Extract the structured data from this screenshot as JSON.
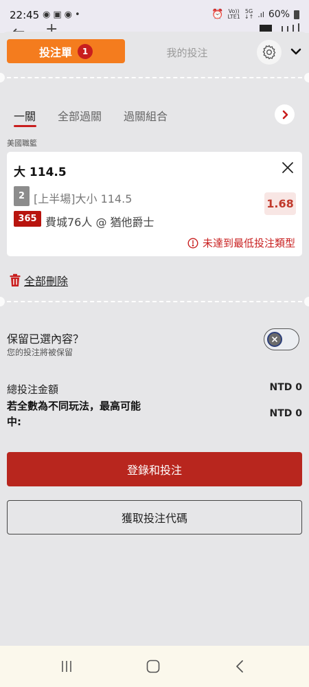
{
  "status_bar": {
    "time": "22:45",
    "battery": "60%",
    "network_top": "Vo))",
    "network_bottom": "LTE1",
    "signal_top": "5G",
    "signal_bottom": "↓↑"
  },
  "header": {
    "betslip_label": "投注單",
    "betslip_count": "1",
    "mybets_label": "我的投注"
  },
  "mode_tabs": [
    "一關",
    "全部過關",
    "過關組合"
  ],
  "league": "美國職籃",
  "selection": {
    "name": "大 114.5",
    "period": "2",
    "market": "[上半場]大小 114.5",
    "provider": "365",
    "match": "費城76人 @ 猶他爵士",
    "odds": "1.68",
    "warning": "未達到最低投注類型"
  },
  "delete_all_label": "全部刪除",
  "keep": {
    "title": "保留已選內容？",
    "subtitle": "您的投注將被保留"
  },
  "totals": {
    "stake_label": "總投注金額",
    "stake_value": "NTD 0",
    "max_label": "若全數為不同玩法，最高可能中:",
    "max_value": "NTD 0"
  },
  "buttons": {
    "login_bet": "登錄和投注",
    "get_code": "獲取投注代碼"
  },
  "colors": {
    "accent_orange": "#f47c1e",
    "brand_red": "#b8261e",
    "odds_bg": "#f8e6e4"
  }
}
